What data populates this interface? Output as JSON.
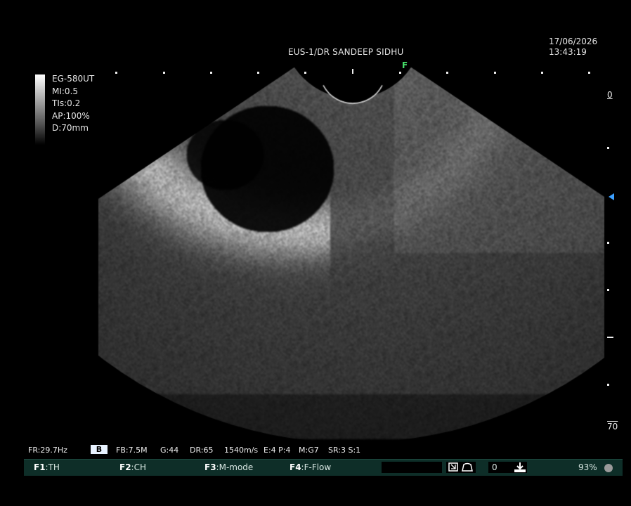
{
  "header": {
    "title": "EUS-1/DR SANDEEP SIDHU",
    "date": "17/06/2026",
    "time": "13:43:19"
  },
  "params": {
    "probe": "EG-580UT",
    "mi": "MI:0.5",
    "tis": "TIs:0.2",
    "ap": "AP:100%",
    "depth": "D:70mm"
  },
  "markers": {
    "focus": "F",
    "depth_top": "0",
    "depth_bottom": "70"
  },
  "status": {
    "fr": "FR:29.7Hz",
    "mode": "B",
    "fb": "FB:7.5M",
    "gain": "G:44",
    "dr": "DR:65",
    "sound_speed": "1540m/s",
    "ep": "E:4 P:4",
    "mg": "M:G7",
    "sr": "SR:3 S:1"
  },
  "function_bar": {
    "f1_key": "F1",
    "f1_label": ":TH",
    "f2_key": "F2",
    "f2_label": ":CH",
    "f3_key": "F3",
    "f3_label": ":M-mode",
    "f4_key": "F4",
    "f4_label": ":F-Flow",
    "counter": "0",
    "battery": "93%"
  },
  "colors": {
    "focus_marker": "#47e06a",
    "depth_arrow": "#3ca0ff",
    "bar_bg": "#0e2e28"
  }
}
